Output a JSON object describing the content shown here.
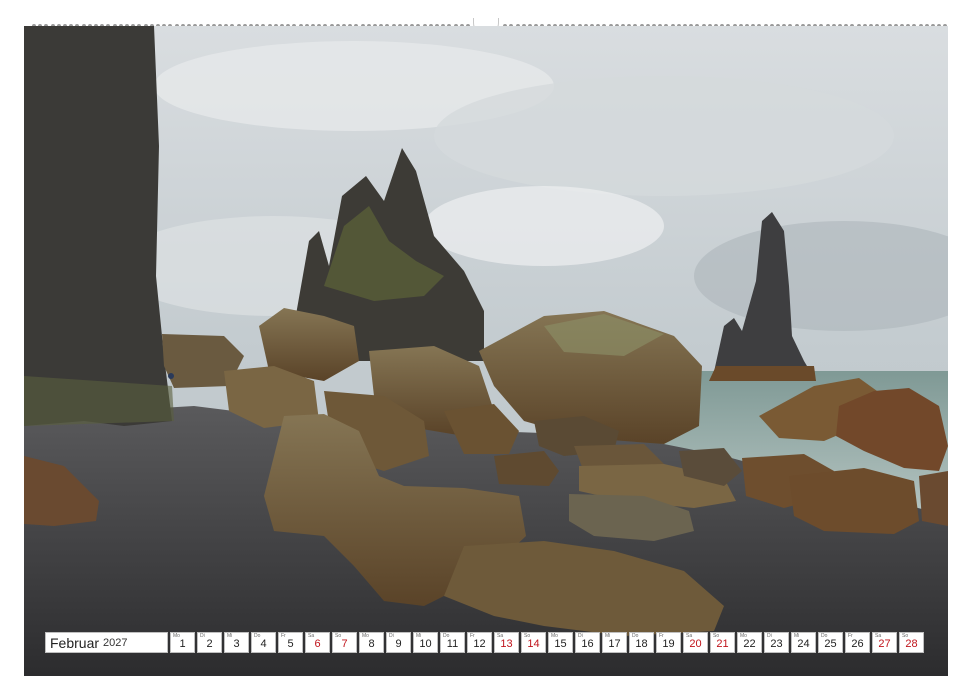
{
  "calendar": {
    "month": "Februar",
    "year": "2027",
    "days": [
      {
        "wd": "Mo",
        "n": "1",
        "we": false
      },
      {
        "wd": "Di",
        "n": "2",
        "we": false
      },
      {
        "wd": "Mi",
        "n": "3",
        "we": false
      },
      {
        "wd": "Do",
        "n": "4",
        "we": false
      },
      {
        "wd": "Fr",
        "n": "5",
        "we": false
      },
      {
        "wd": "Sa",
        "n": "6",
        "we": true
      },
      {
        "wd": "So",
        "n": "7",
        "we": true
      },
      {
        "wd": "Mo",
        "n": "8",
        "we": false
      },
      {
        "wd": "Di",
        "n": "9",
        "we": false
      },
      {
        "wd": "Mi",
        "n": "10",
        "we": false
      },
      {
        "wd": "Do",
        "n": "11",
        "we": false
      },
      {
        "wd": "Fr",
        "n": "12",
        "we": false
      },
      {
        "wd": "Sa",
        "n": "13",
        "we": true
      },
      {
        "wd": "So",
        "n": "14",
        "we": true
      },
      {
        "wd": "Mo",
        "n": "15",
        "we": false
      },
      {
        "wd": "Di",
        "n": "16",
        "we": false
      },
      {
        "wd": "Mi",
        "n": "17",
        "we": false
      },
      {
        "wd": "Do",
        "n": "18",
        "we": false
      },
      {
        "wd": "Fr",
        "n": "19",
        "we": false
      },
      {
        "wd": "Sa",
        "n": "20",
        "we": true
      },
      {
        "wd": "So",
        "n": "21",
        "we": true
      },
      {
        "wd": "Mo",
        "n": "22",
        "we": false
      },
      {
        "wd": "Di",
        "n": "23",
        "we": false
      },
      {
        "wd": "Mi",
        "n": "24",
        "we": false
      },
      {
        "wd": "Do",
        "n": "25",
        "we": false
      },
      {
        "wd": "Fr",
        "n": "26",
        "we": false
      },
      {
        "wd": "Sa",
        "n": "27",
        "we": true
      },
      {
        "wd": "So",
        "n": "28",
        "we": true
      }
    ]
  },
  "colors": {
    "weekend": "#c0141c",
    "sky": "#c9cfd2",
    "sand": "#3a3a3c",
    "rock": "#6b5a3c",
    "sea": "#8fa7a4"
  }
}
